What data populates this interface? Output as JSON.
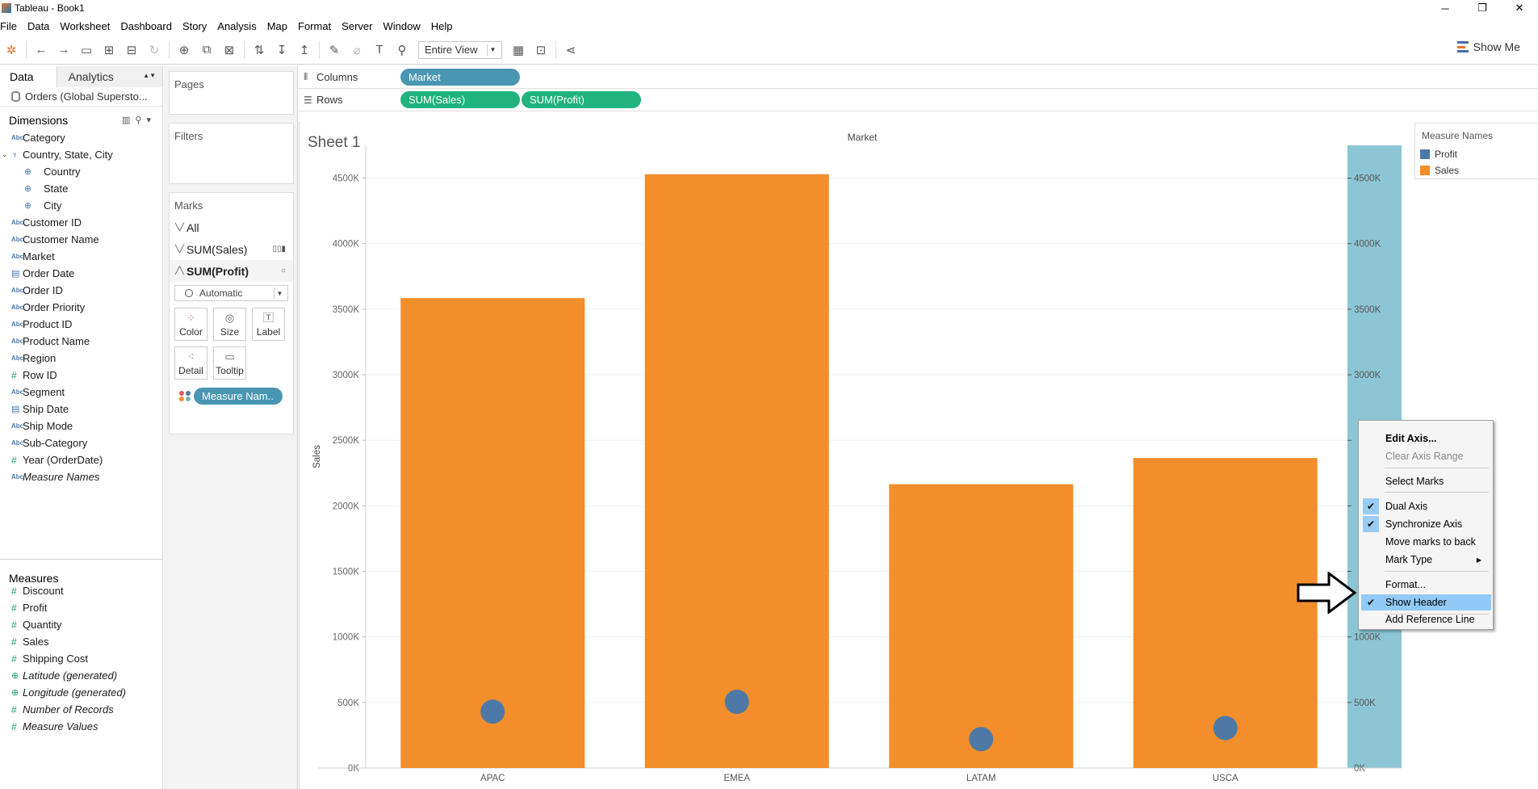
{
  "window": {
    "title": "Tableau - Book1",
    "controls": [
      "─",
      "❐",
      "✕"
    ]
  },
  "menu": [
    "File",
    "Data",
    "Worksheet",
    "Dashboard",
    "Story",
    "Analysis",
    "Map",
    "Format",
    "Server",
    "Window",
    "Help"
  ],
  "toolbar": {
    "fit": "Entire View",
    "show_me": "Show Me"
  },
  "data_pane": {
    "tabs": [
      "Data",
      "Analytics"
    ],
    "datasource": "Orders (Global Supersto...",
    "dimensions_label": "Dimensions",
    "dimensions": [
      {
        "name": "Category",
        "type": "Abc"
      },
      {
        "name": "Country, State, City",
        "type": "hier"
      },
      {
        "name": "Country",
        "type": "geo",
        "indent": true
      },
      {
        "name": "State",
        "type": "geo",
        "indent": true
      },
      {
        "name": "City",
        "type": "geo",
        "indent": true
      },
      {
        "name": "Customer ID",
        "type": "Abc"
      },
      {
        "name": "Customer Name",
        "type": "Abc"
      },
      {
        "name": "Market",
        "type": "Abc"
      },
      {
        "name": "Order Date",
        "type": "date"
      },
      {
        "name": "Order ID",
        "type": "Abc"
      },
      {
        "name": "Order Priority",
        "type": "Abc"
      },
      {
        "name": "Product ID",
        "type": "Abc"
      },
      {
        "name": "Product Name",
        "type": "Abc"
      },
      {
        "name": "Region",
        "type": "Abc"
      },
      {
        "name": "Row ID",
        "type": "num"
      },
      {
        "name": "Segment",
        "type": "Abc"
      },
      {
        "name": "Ship Date",
        "type": "date"
      },
      {
        "name": "Ship Mode",
        "type": "Abc"
      },
      {
        "name": "Sub-Category",
        "type": "Abc"
      },
      {
        "name": "Year (OrderDate)",
        "type": "num"
      },
      {
        "name": "Measure Names",
        "type": "Abc",
        "italic": true
      }
    ],
    "measures_label": "Measures",
    "measures": [
      {
        "name": "Discount",
        "type": "num"
      },
      {
        "name": "Profit",
        "type": "num"
      },
      {
        "name": "Quantity",
        "type": "num"
      },
      {
        "name": "Sales",
        "type": "num"
      },
      {
        "name": "Shipping Cost",
        "type": "num"
      },
      {
        "name": "Latitude (generated)",
        "type": "geo",
        "italic": true
      },
      {
        "name": "Longitude (generated)",
        "type": "geo",
        "italic": true
      },
      {
        "name": "Number of Records",
        "type": "num",
        "italic": true
      },
      {
        "name": "Measure Values",
        "type": "num",
        "italic": true
      }
    ]
  },
  "cards": {
    "pages": "Pages",
    "filters": "Filters",
    "marks": "Marks",
    "mark_all": "All",
    "mark_sales": "SUM(Sales)",
    "mark_profit": "SUM(Profit)",
    "mark_type": "Automatic",
    "buttons": [
      "Color",
      "Size",
      "Label",
      "Detail",
      "Tooltip"
    ],
    "color_pill": "Measure Nam.."
  },
  "shelves": {
    "columns_label": "Columns",
    "rows_label": "Rows",
    "columns": [
      "Market"
    ],
    "rows": [
      "SUM(Sales)",
      "SUM(Profit)"
    ]
  },
  "sheet": {
    "title": "Sheet 1"
  },
  "chart_data": {
    "type": "bar",
    "title": "Market",
    "categories": [
      "APAC",
      "EMEA",
      "LATAM",
      "USCA"
    ],
    "ylabel": "Sales",
    "ylim": [
      0,
      4750000
    ],
    "y_ticks": [
      "0K",
      "500K",
      "1000K",
      "1500K",
      "2000K",
      "2500K",
      "3000K",
      "3500K",
      "4000K",
      "4500K"
    ],
    "right_ticks": [
      "0K",
      "500K",
      "1000K",
      "",
      "",
      "",
      "3000K",
      "3500K",
      "4000K",
      "4500K"
    ],
    "series": [
      {
        "name": "Sales",
        "mark": "bar",
        "color": "#f28e2b",
        "values": [
          3585000,
          4530000,
          2165000,
          2365000
        ]
      },
      {
        "name": "Profit",
        "mark": "circle",
        "color": "#4e79a7",
        "values": [
          430000,
          505000,
          220000,
          305000
        ]
      }
    ],
    "grid": true
  },
  "legend": {
    "title": "Measure Names",
    "items": [
      {
        "label": "Profit",
        "color": "#4e79a7"
      },
      {
        "label": "Sales",
        "color": "#f28e2b"
      }
    ]
  },
  "context_menu": {
    "items": [
      {
        "label": "Edit Axis...",
        "bold": true
      },
      {
        "label": "Clear Axis Range",
        "disabled": true
      },
      {
        "label": "Select Marks"
      },
      {
        "label": "Dual Axis",
        "checked": true
      },
      {
        "label": "Synchronize Axis",
        "checked": true
      },
      {
        "label": "Move marks to back"
      },
      {
        "label": "Mark Type",
        "submenu": true
      },
      {
        "label": "Format..."
      },
      {
        "label": "Show Header",
        "checked": true,
        "highlighted": true
      },
      {
        "label": "Add Reference Line"
      }
    ]
  }
}
